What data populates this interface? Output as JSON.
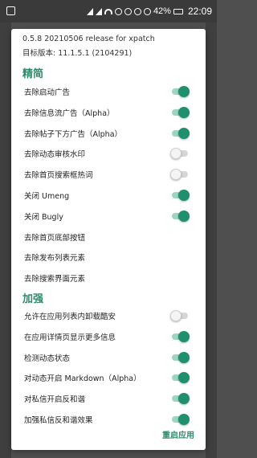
{
  "status_bar": {
    "battery_text": "42%",
    "time": "22:09"
  },
  "dialog": {
    "version_line": "0.5.8 20210506 release for xpatch",
    "target_version_line": "目标版本: 11.1.5.1 (2104291)",
    "sections": [
      {
        "title": "精简",
        "items": [
          {
            "label": "去除启动广告",
            "type": "switch",
            "on": true
          },
          {
            "label": "去除信息流广告（Alpha）",
            "type": "switch",
            "on": true
          },
          {
            "label": "去除帖子下方广告（Alpha）",
            "type": "switch",
            "on": true
          },
          {
            "label": "去除动态审核水印",
            "type": "switch",
            "on": false
          },
          {
            "label": "去除首页搜索框热词",
            "type": "switch",
            "on": false
          },
          {
            "label": "关闭 Umeng",
            "type": "switch",
            "on": true
          },
          {
            "label": "关闭 Bugly",
            "type": "switch",
            "on": true
          },
          {
            "label": "去除首页底部按钮",
            "type": "item"
          },
          {
            "label": "去除发布列表元素",
            "type": "item"
          },
          {
            "label": "去除搜索界面元素",
            "type": "item"
          }
        ]
      },
      {
        "title": "加强",
        "items": [
          {
            "label": "允许在应用列表内卸载酷安",
            "type": "switch",
            "on": false
          },
          {
            "label": "在应用详情页显示更多信息",
            "type": "switch",
            "on": true
          },
          {
            "label": "检测动态状态",
            "type": "switch",
            "on": true
          },
          {
            "label": "对动态开启 Markdown（Alpha）",
            "type": "switch",
            "on": true
          },
          {
            "label": "对私信开启反和谐",
            "type": "switch",
            "on": true
          },
          {
            "label": "加强私信反和谐效果",
            "type": "switch",
            "on": true
          }
        ]
      }
    ],
    "restart_label": "重启应用"
  },
  "colors": {
    "accent": "#2e8b6a",
    "switch_on_thumb": "#1f8f6d",
    "switch_on_track": "#9fd4c2",
    "switch_off_track": "#d6d6d6"
  }
}
